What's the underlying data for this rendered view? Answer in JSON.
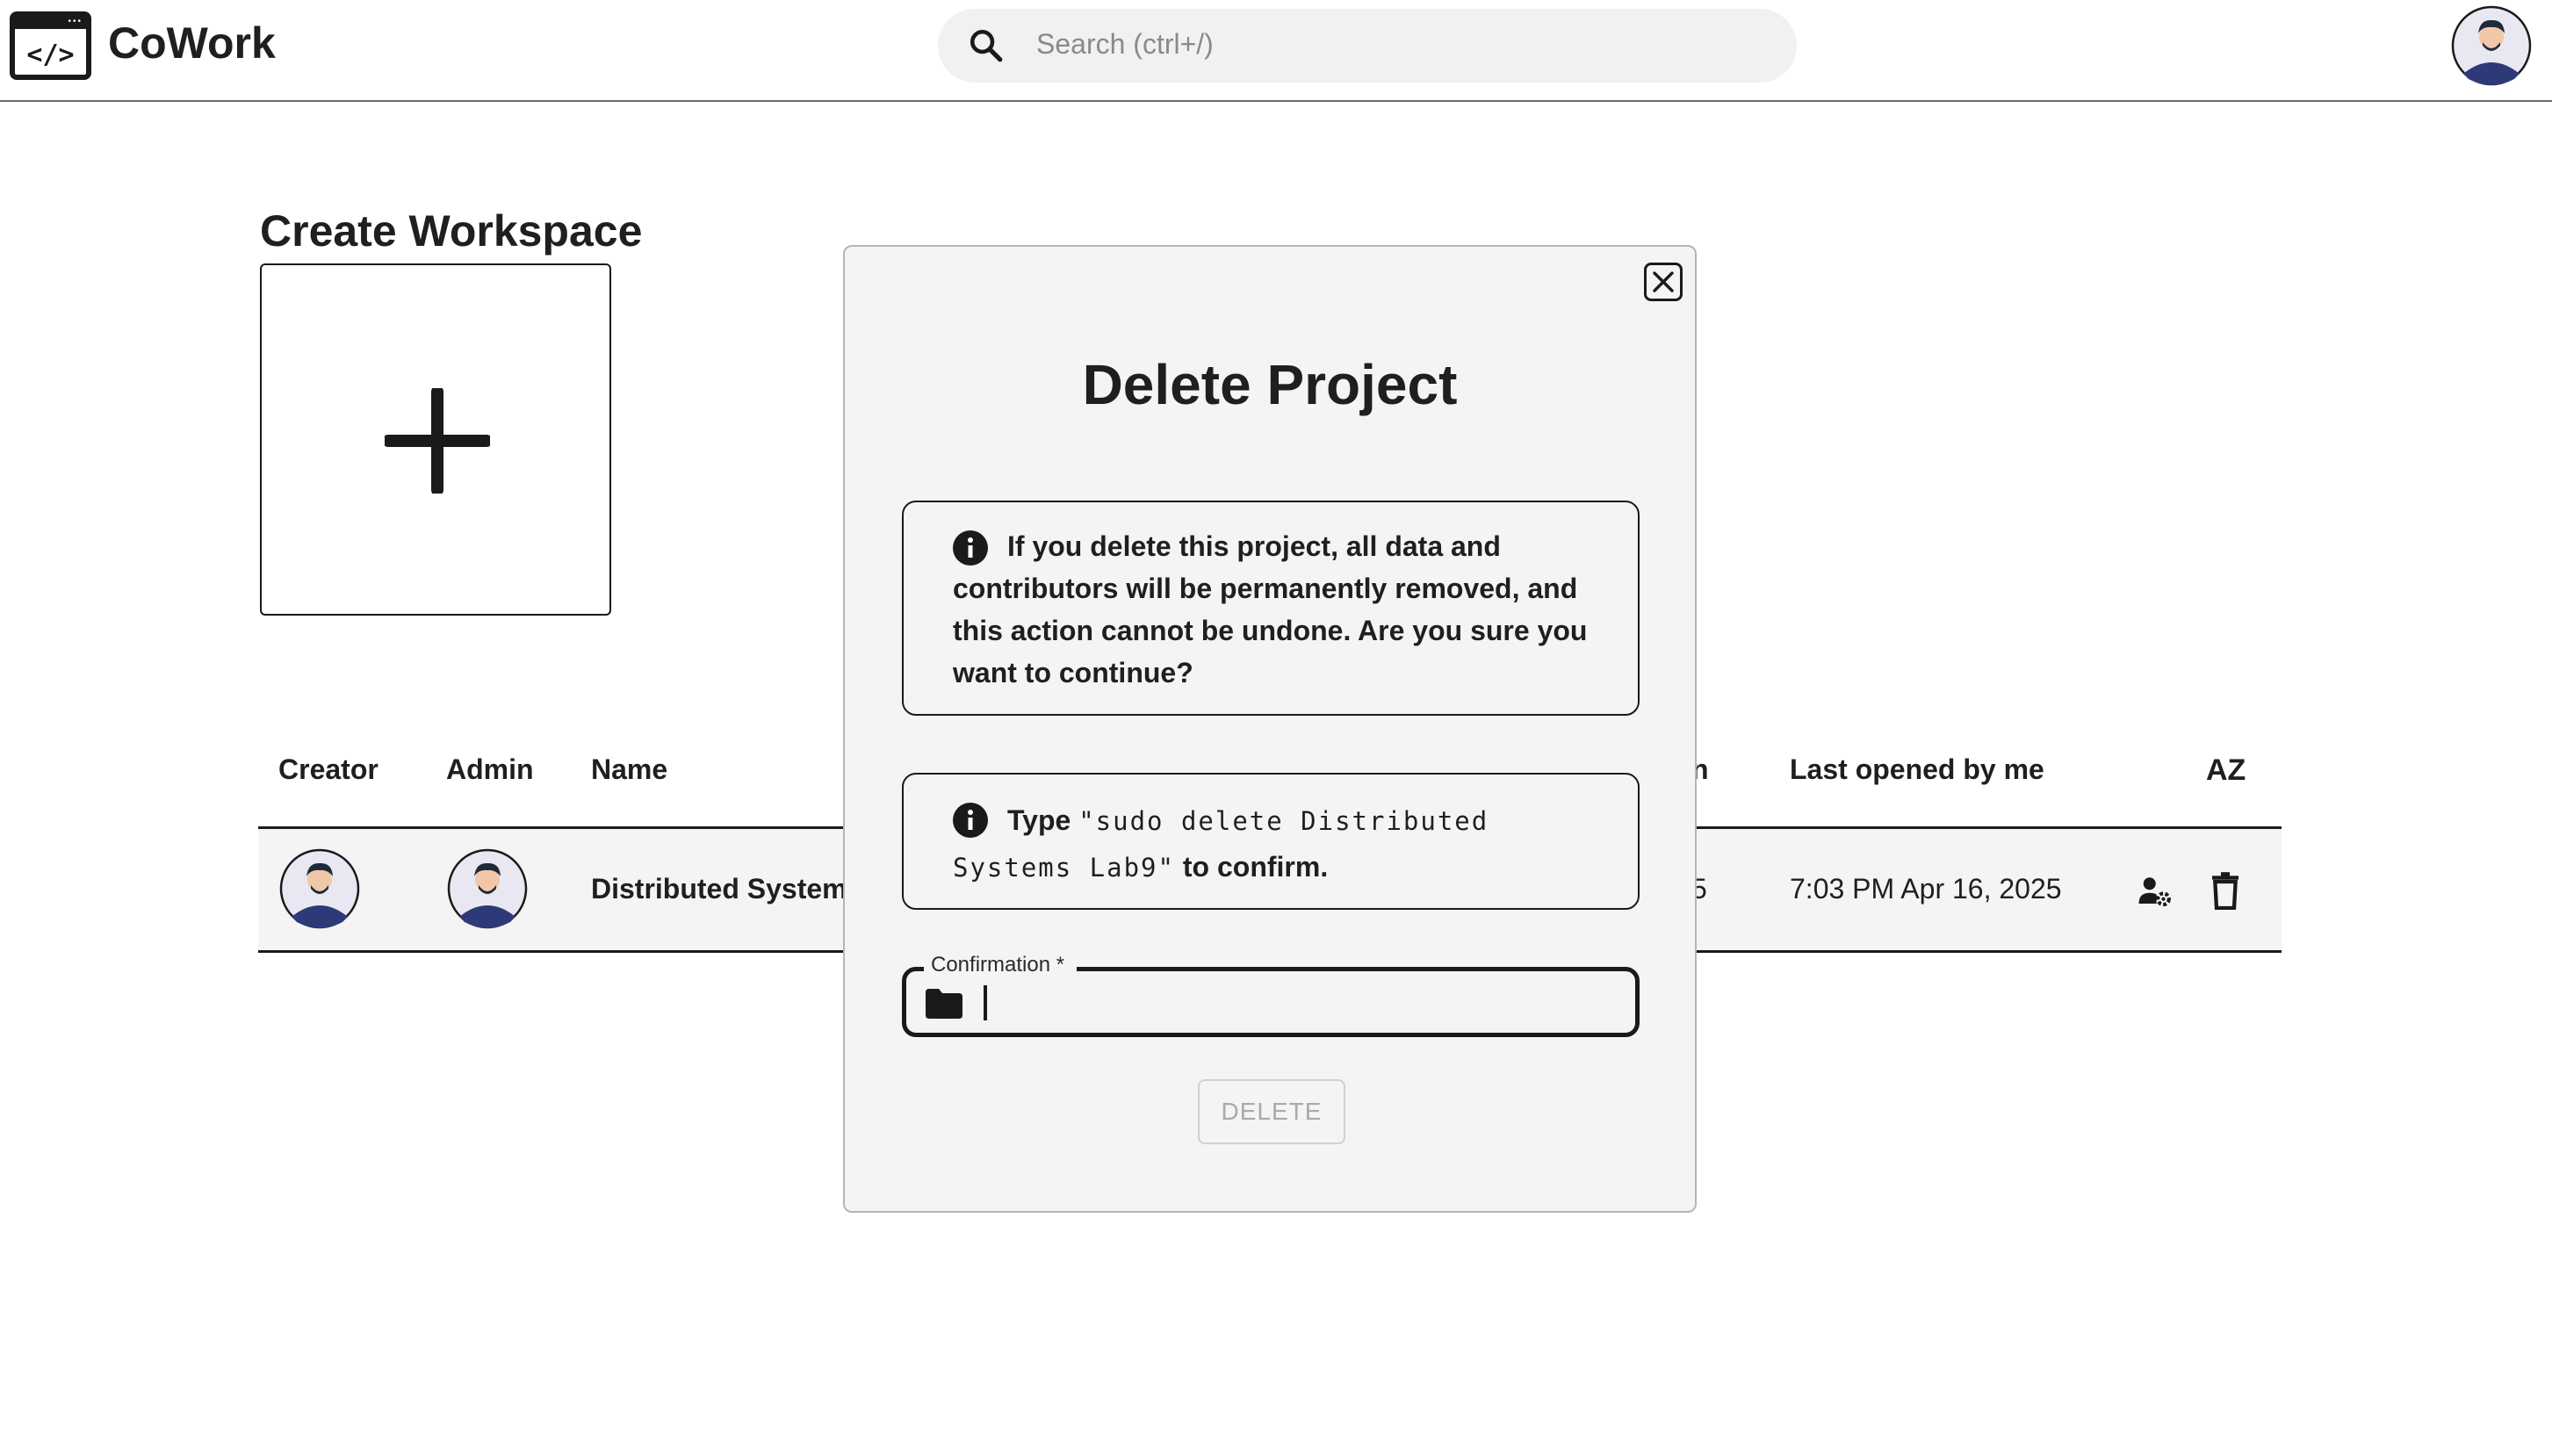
{
  "header": {
    "brand": "CoWork",
    "logo_code": "</>",
    "search": {
      "placeholder": "Search (ctrl+/)"
    }
  },
  "workspace": {
    "title": "Create Workspace"
  },
  "table": {
    "headers": {
      "creator": "Creator",
      "admin": "Admin",
      "name": "Name",
      "hidden_col_tail": "n",
      "last_opened": "Last opened by me",
      "sort": "AZ"
    },
    "rows": [
      {
        "name": "Distributed System",
        "hidden_cell_tail": "5",
        "last_opened": "7:03 PM Apr 16, 2025"
      }
    ]
  },
  "modal": {
    "title": "Delete Project",
    "warning": "If you delete this project, all data and contributors will be permanently removed, and this action cannot be undone. Are you sure you want to continue?",
    "instruction_prefix": "Type",
    "instruction_code_line1": "\"sudo delete Distributed",
    "instruction_code_line2": "Systems Lab9\"",
    "instruction_suffix": "to confirm.",
    "field_label": "Confirmation *",
    "field_value": "",
    "delete_label": "DELETE"
  },
  "icons": {
    "logo": "code-window-icon",
    "search": "search-icon",
    "close": "close-icon",
    "info": "info-icon",
    "folder": "folder-icon",
    "manage_user": "manage-user-icon",
    "delete": "trash-icon",
    "sort": "sort-az-icon",
    "add": "plus-icon"
  }
}
